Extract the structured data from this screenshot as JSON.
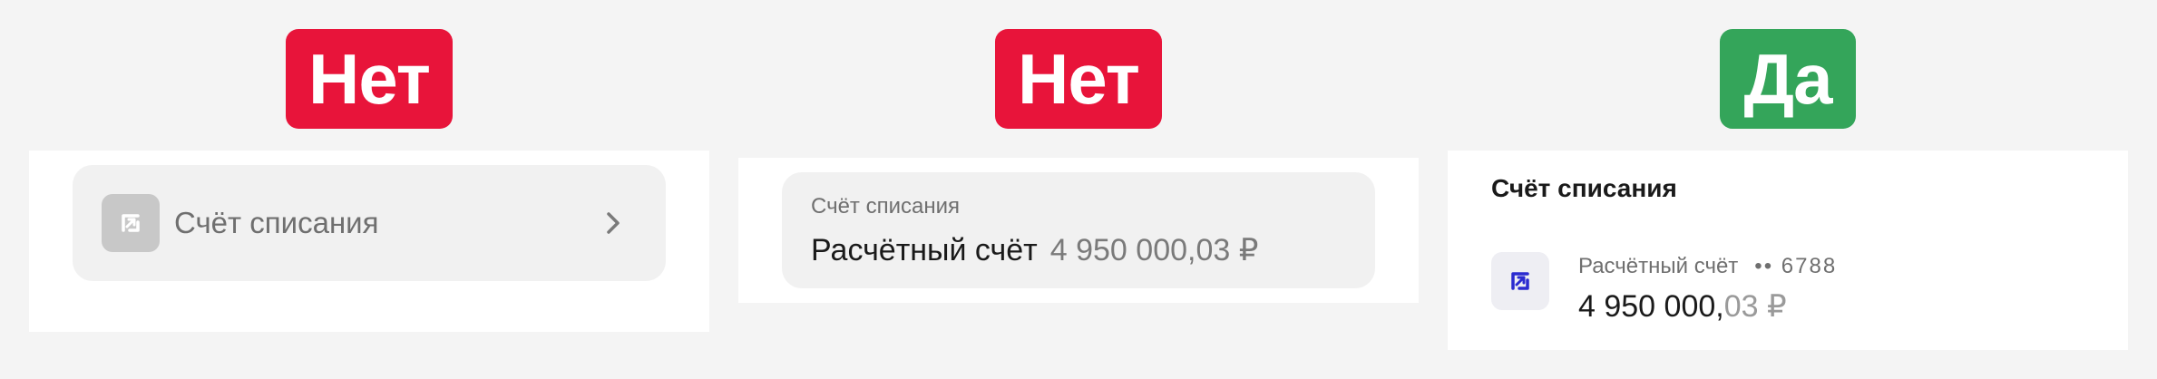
{
  "badges": [
    {
      "label": "Нет",
      "color": "#e8143a"
    },
    {
      "label": "Нет",
      "color": "#e8143a"
    },
    {
      "label": "Да",
      "color": "#34a55a"
    }
  ],
  "variant1": {
    "label": "Счёт списания",
    "icon": "account-transfer-icon",
    "chevron": "chevron-right-icon"
  },
  "variant2": {
    "caption": "Счёт списания",
    "account_name": "Расчётный счёт",
    "amount": "4 950 000,03 ₽"
  },
  "variant3": {
    "title": "Счёт списания",
    "account_name": "Расчётный счёт",
    "account_mask": "•• 6788",
    "amount_main": "4 950 000,",
    "amount_fraction": "03 ₽",
    "icon": "account-transfer-icon",
    "accent": "#2b2bd0"
  }
}
